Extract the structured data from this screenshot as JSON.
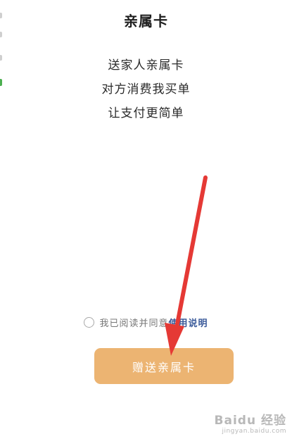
{
  "header": {
    "title": "亲属卡"
  },
  "description": {
    "lines": [
      "送家人亲属卡",
      "对方消费我买单",
      "让支付更简单"
    ]
  },
  "agreement": {
    "text": "我已阅读并同意",
    "link": "使用说明",
    "checked": false
  },
  "action": {
    "gift_label": "赠送亲属卡",
    "button_color": "#ecb472"
  },
  "annotation": {
    "arrow_color": "#e53935"
  },
  "watermark": {
    "brand": "Baidu 经验",
    "url": "jingyan.baidu.com"
  }
}
